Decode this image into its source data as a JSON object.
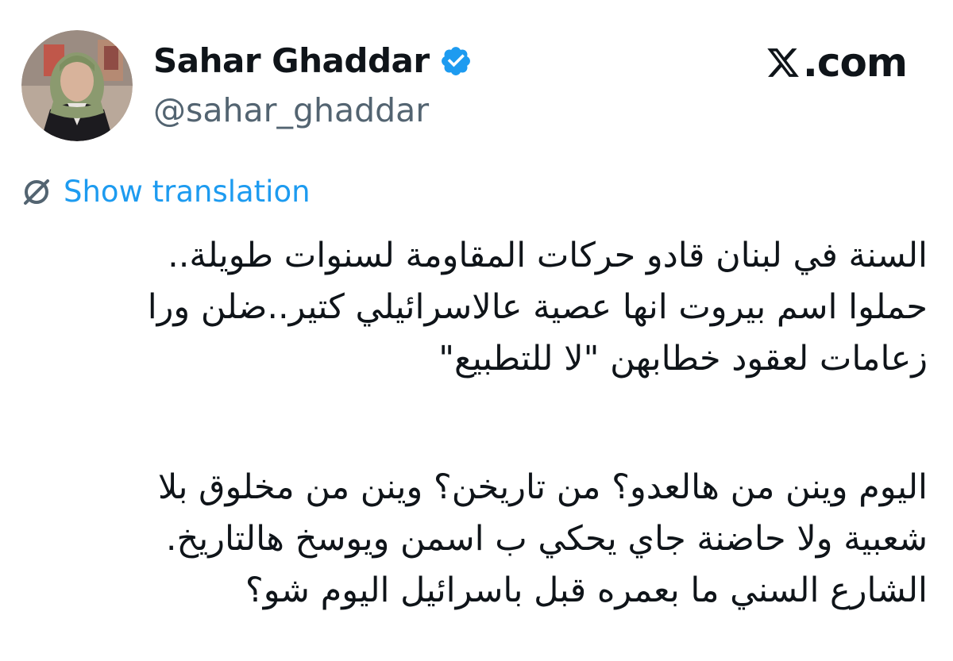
{
  "author": {
    "display_name": "Sahar Ghaddar",
    "handle": "@sahar_ghaddar",
    "verified": true,
    "avatar_icon": "profile-photo-avatar"
  },
  "brand": {
    "logo_icon": "x-logo-icon",
    "domain_suffix": ".com"
  },
  "translation": {
    "icon": "globe-slash-icon",
    "label": "Show translation",
    "color": "#1d9bf0"
  },
  "tweet": {
    "paragraphs": [
      {
        "lines": [
          "السنة في لبنان قادو حركات المقاومة لسنوات طويلة..",
          "حملوا اسم بيروت انها عصية عالاسرائيلي كتير..ضلن ورا",
          "زعامات لعقود خطابهن \"لا للتطبيع\""
        ]
      },
      {
        "lines": [
          "اليوم وينن من هالعدو؟ من تاريخن؟ وينن من مخلوق بلا",
          "شعبية ولا حاضنة جاي يحكي ب اسمن ويوسخ هالتاريخ.",
          "الشارع السني ما بعمره قبل باسرائيل اليوم شو؟"
        ]
      }
    ]
  },
  "colors": {
    "text_primary": "#0f1419",
    "text_secondary": "#536471",
    "accent": "#1d9bf0",
    "background": "#ffffff"
  }
}
